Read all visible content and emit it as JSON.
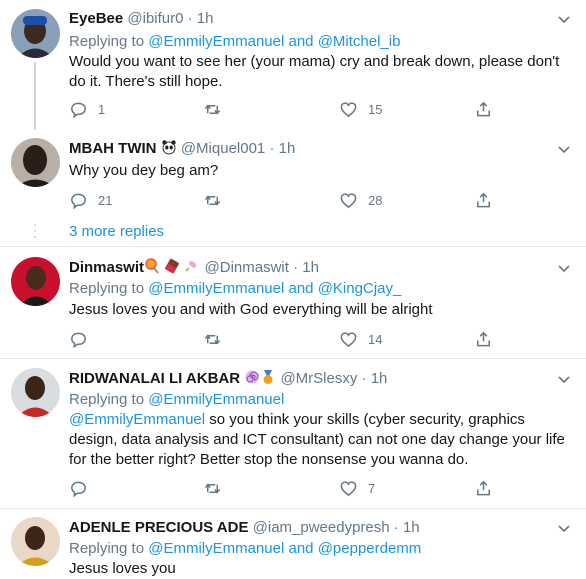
{
  "tweets": [
    {
      "name": "EyeBee",
      "handle": "@ibifur0",
      "time": "1h",
      "replying_label": "Replying to",
      "reply_users": [
        "@EmmilyEmmanuel",
        "and",
        "@Mitchel_ib"
      ],
      "text": "Would you want to see her (your mama) cry and break down, please don't do it. There's still hope.",
      "replies": "1",
      "retweets": "",
      "likes": "15"
    },
    {
      "name": "MBAH TWIN",
      "handle": "@Miquel001",
      "time": "1h",
      "text": "Why you dey beg am?",
      "replies": "21",
      "retweets": "",
      "likes": "28"
    },
    {
      "name": "Dinmaswit",
      "handle": "@Dinmaswit",
      "time": "1h",
      "replying_label": "Replying to",
      "reply_users": [
        "@EmmilyEmmanuel",
        "and",
        "@KingCjay_"
      ],
      "text": "Jesus loves you and with God everything will be alright",
      "replies": "",
      "retweets": "",
      "likes": "14"
    },
    {
      "name": "RIDWANALAI LI AKBAR",
      "handle": "@MrSlesxy",
      "time": "1h",
      "replying_label": "Replying to",
      "reply_users": [
        "@EmmilyEmmanuel"
      ],
      "text_mention": "@EmmilyEmmanuel",
      "text": " so you think your skills (cyber security, graphics design, data analysis and ICT consultant) can not one day change your life for the better right? Better stop the nonsense you wanna do.",
      "replies": "",
      "retweets": "",
      "likes": "7"
    },
    {
      "name": "ADENLE PRECIOUS ADE",
      "handle": "@iam_pweedypresh",
      "time": "1h",
      "replying_label": "Replying to",
      "reply_users": [
        "@EmmilyEmmanuel",
        "and",
        "@pepperdemm"
      ],
      "text": "Jesus loves you"
    }
  ],
  "show_more": "3 more replies",
  "separator": "·",
  "colors": {
    "link": "#1b95e0",
    "muted": "#657786",
    "divider": "#e6ecf0",
    "thread": "#ccd6dd"
  }
}
